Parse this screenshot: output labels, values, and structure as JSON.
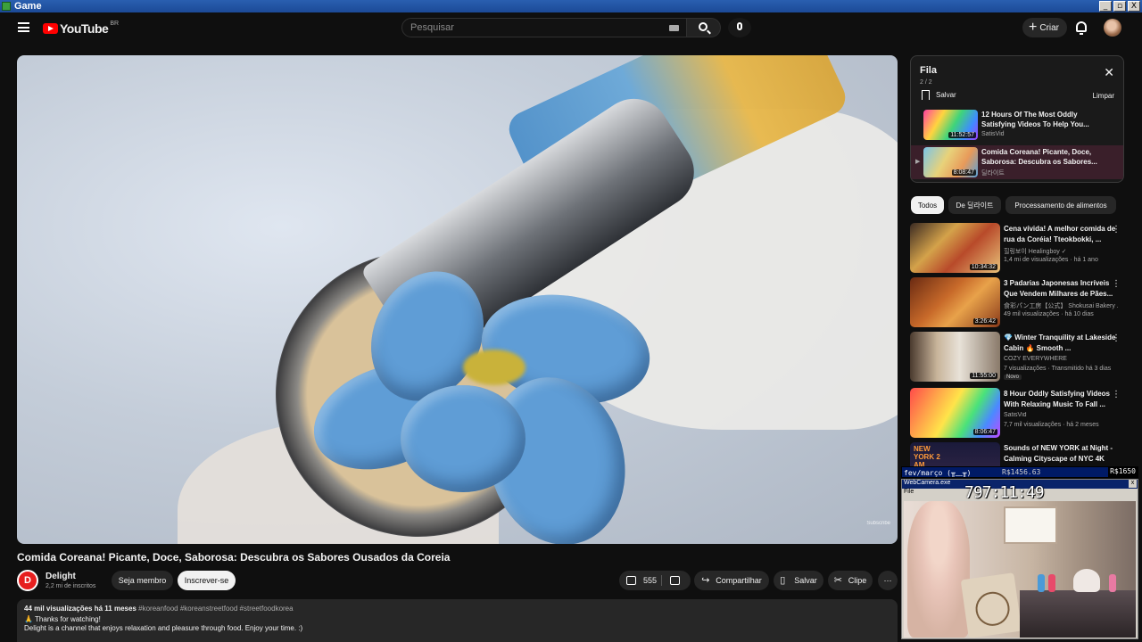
{
  "window": {
    "title": "Game",
    "controls": [
      "_",
      "▫",
      "X"
    ]
  },
  "topbar": {
    "logo_text": "YouTube",
    "logo_country": "BR",
    "search_placeholder": "Pesquisar",
    "create_label": "Criar",
    "icons": [
      "menu-icon",
      "keyboard-icon",
      "search-icon",
      "mic-icon",
      "plus-icon",
      "bell-icon"
    ]
  },
  "video": {
    "title": "Comida Coreana! Picante, Doce, Saborosa: Descubra os Sabores Ousados da Coreia",
    "watermark": "Subscribe",
    "channel": {
      "name": "Delight",
      "subs": "2,2 mi de inscritos",
      "avatar_letter": "D"
    },
    "member_label": "Seja membro",
    "subscribe_label": "Inscrever-se",
    "likes": "555",
    "share_label": "Compartilhar",
    "save_label": "Salvar",
    "clip_label": "Clipe",
    "more_label": "⋯",
    "description": {
      "views": "44 mil visualizações",
      "age": "há 11 meses",
      "tags": "#koreanfood #koreanstreetfood #streetfoodkorea",
      "line1": "🙏 Thanks for watching!",
      "line2": "Delight is a channel that enjoys relaxation and pleasure through food. Enjoy your time. :)"
    }
  },
  "queue": {
    "title": "Fila",
    "count": "2 / 2",
    "save_label": "Salvar",
    "clear_label": "Limpar",
    "close_label": "✕",
    "items": [
      {
        "title": "12 Hours Of The Most Oddly Satisfying Videos To Help You...",
        "channel": "SatisVid",
        "duration": "11:52:57",
        "active": false
      },
      {
        "title": "Comida Coreana! Picante, Doce, Saborosa: Descubra os Sabores...",
        "channel": "딜라이트",
        "duration": "8:08:47",
        "active": true,
        "arrow": "▶"
      }
    ]
  },
  "chips": [
    "Todos",
    "De 딜라이트",
    "Processamento de alimentos"
  ],
  "recommendations": [
    {
      "title": "Cena vívida! A melhor comida de rua da Coréia! Tteokbokki, ...",
      "channel": "힐링보이 Healingboy ✓",
      "meta": "1,4 mi de visualizações · há 1 ano",
      "duration": "10:34:32",
      "badge": ""
    },
    {
      "title": "3 Padarias Japonesas Incríveis Que Vendem Milhares de Pães...",
      "channel": "食彩パン工房【公式】 Shokusai Bakery ...",
      "meta": "49 mil visualizações · há 10 dias",
      "duration": "3:26:42",
      "badge": ""
    },
    {
      "title": "💎 Winter Tranquility at Lakeside Cabin 🔥 Smooth ...",
      "channel": "COZY EVERYWHERE",
      "meta": "7 visualizações · Transmitido há 3 dias",
      "duration": "11:55:00",
      "badge": "Novo"
    },
    {
      "title": "8 Hour Oddly Satisfying Videos With Relaxing Music To Fall ...",
      "channel": "SatisVid",
      "meta": "7,7 mil visualizações · há 2 meses",
      "duration": "8:06:47",
      "badge": ""
    },
    {
      "title": "Sounds of NEW YORK at Night - Calming Cityscape of NYC 4K",
      "channel": "",
      "meta": "",
      "duration": "",
      "badge": "",
      "thumb_text": "NEW YORK 2 AM"
    }
  ],
  "overlay": {
    "bar_left": "fev/março (╥﹏╥)",
    "bar_mid": "R$1456.63",
    "bar_right": "R$1650",
    "cam_title": "WebCamera.exe",
    "cam_menu": "File",
    "timer": "797:11:49"
  },
  "colors": {
    "background": "#0f0f0f",
    "accent_red": "#ff0000",
    "queue_active": "#3a1f2a",
    "overlay_blue": "#001a66"
  }
}
